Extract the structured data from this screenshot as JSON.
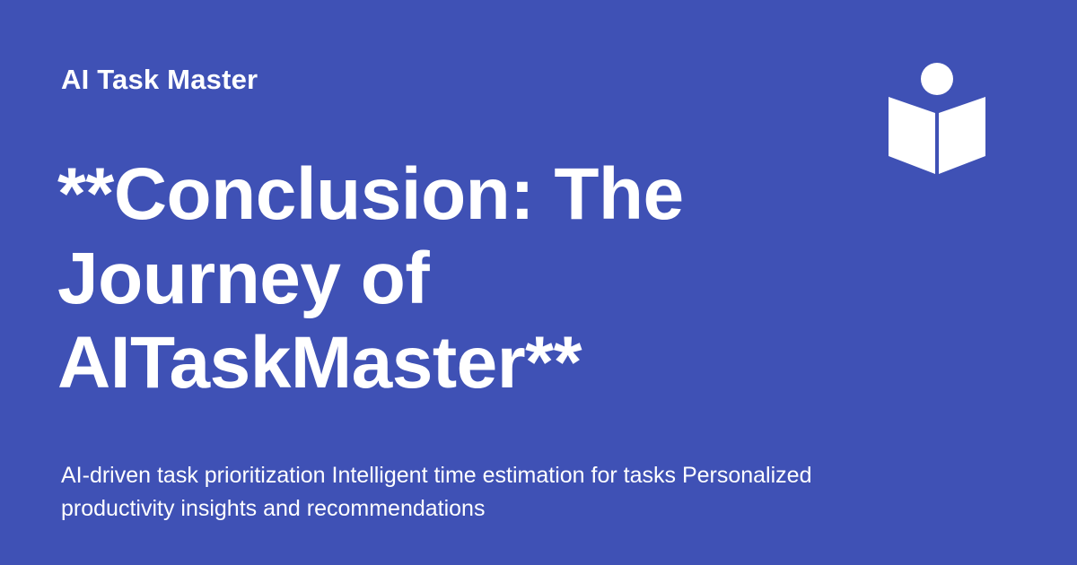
{
  "brand": {
    "name": "AI Task Master"
  },
  "hero": {
    "title": "**Conclusion: The Journey of AITaskMaster**",
    "subtitle": "AI-driven task prioritization Intelligent time estimation for tasks Personalized productivity insights and recommendations"
  },
  "logo": {
    "icon": "reader-book-icon"
  },
  "colors": {
    "background": "#3f51b5",
    "text": "#ffffff"
  }
}
